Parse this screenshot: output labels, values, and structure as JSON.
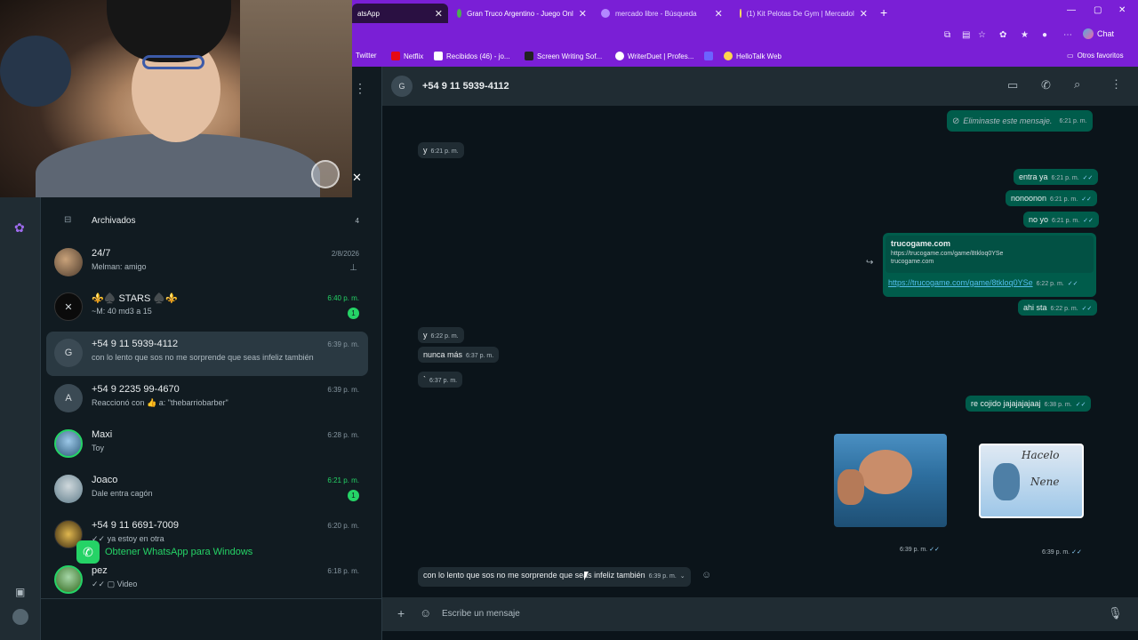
{
  "tabs": [
    {
      "label": "atsApp",
      "active": true
    },
    {
      "label": "Gran Truco Argentino - Juego Onl",
      "active": false
    },
    {
      "label": "mercado libre - Búsqueda",
      "active": false
    },
    {
      "label": "(1) Kit Pelotas De Gym | Mercadol",
      "active": false
    }
  ],
  "browser": {
    "chat_label": "Chat"
  },
  "bookmarks": [
    "Twitter",
    "Netflix",
    "Recibidos (46) - jo...",
    "Screen Writing Sof...",
    "WriterDuet | Profes...",
    "HelloTalk Web",
    "Otros favoritos"
  ],
  "sidebar": {
    "archived_label": "Archivados",
    "archived_count": "4",
    "chats": [
      {
        "name": "24/7",
        "preview": "Melman: amigo",
        "time": "2/8/2026"
      },
      {
        "name": "⚜️♠️ STARS ♠️⚜️",
        "preview": "~M: 40 md3 a 15",
        "time": "6:40 p. m.",
        "badge": "1"
      },
      {
        "name": "+54 9 11 5939-4112",
        "preview": "con lo lento que sos no me sorprende que seas infeliz también",
        "time": "6:39 p. m.",
        "initial": "G"
      },
      {
        "name": "+54 9 2235 99-4670",
        "preview": "Reaccionó con 👍 a: \"thebarriobarber\"",
        "time": "6:39 p. m.",
        "initial": "A"
      },
      {
        "name": "Maxi",
        "preview": "Toy",
        "time": "6:28 p. m."
      },
      {
        "name": "Joaco",
        "preview": "Dale entra cagón",
        "time": "6:21 p. m.",
        "badge": "1"
      },
      {
        "name": "+54 9 11 6691-7009",
        "preview": "✓✓ ya estoy en otra",
        "time": "6:20 p. m."
      },
      {
        "name": "pez",
        "preview": "✓✓ ▢ Video",
        "time": "6:18 p. m."
      }
    ],
    "get_app": "Obtener WhatsApp para Windows"
  },
  "chat": {
    "header_name": "+54 9 11 5939-4112",
    "header_initial": "G",
    "messages": {
      "deleted": "Eliminaste este mensaje.",
      "deleted_time": "6:21 p. m.",
      "m1": "y",
      "m1_time": "6:21 p. m.",
      "m2": "entra ya",
      "m2_time": "6:21 p. m.",
      "m3": "nonoonon",
      "m3_time": "6:21 p. m.",
      "m4": "no yo",
      "m4_time": "6:21 p. m.",
      "link_title": "trucogame.com",
      "link_url_small": "https://trucogame.com/game/8tkloq0YSe",
      "link_domain": "trucogame.com",
      "link_url": "https://trucogame.com/game/8tkloq0YSe",
      "link_time": "6:22 p. m.",
      "m5": "ahi sta",
      "m5_time": "6:22 p. m.",
      "m6": "y",
      "m6_time": "6:22 p. m.",
      "m7": "nunca más",
      "m7_time": "6:37 p. m.",
      "m8": "`",
      "m8_time": "6:37 p. m.",
      "m9": "re cojido jajajajajaaj",
      "m9_time": "6:38 p. m.",
      "img1_time": "6:39 p. m.",
      "sticker_text_1": "Hacelo",
      "sticker_text_2": "Nene",
      "img2_time": "6:39 p. m.",
      "m10": "con lo lento que sos no me sorprende que seas infeliz también",
      "m10_time": "6:39 p. m."
    },
    "composer_placeholder": "Escribe un mensaje"
  },
  "colors": {
    "accent": "#25d366",
    "browser": "#7a1fd6",
    "outgoing": "#005c4b",
    "incoming": "#202c33"
  }
}
